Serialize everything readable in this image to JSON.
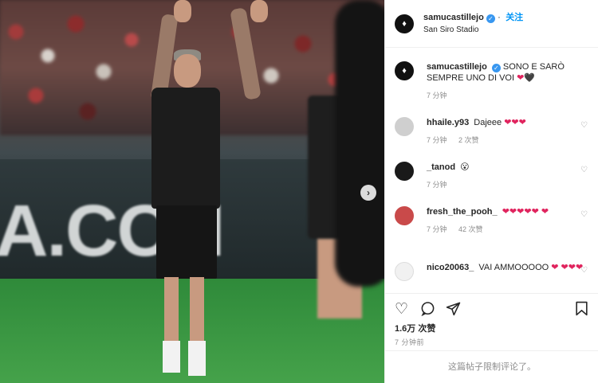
{
  "photo": {
    "ad_text": "A.CON",
    "next_icon": "chevron-right-icon"
  },
  "post": {
    "username": "samucastillejo",
    "verified_icon": "verified-badge-icon",
    "follow_label": "关注",
    "location": "San Siro Stadio"
  },
  "caption": {
    "username": "samucastillejo",
    "text": "SONO E SARÒ SEMPRE UNO DI VOI",
    "emoji": "❤🖤",
    "time": "7 分钟"
  },
  "comments": [
    {
      "username": "hhaile.y93",
      "text": "Dajeee",
      "emoji": "❤❤❤",
      "time": "7 分钟",
      "likes": "2 次赞",
      "avatar_color": "#cfcfcf"
    },
    {
      "username": "_tanod",
      "text": "",
      "emoji": "😮",
      "time": "7 分钟",
      "likes": "",
      "avatar_color": "#1a1a1a"
    },
    {
      "username": "fresh_the_pooh_",
      "text": "",
      "emoji": "❤❤❤❤❤ ❤",
      "time": "7 分钟",
      "likes": "42 次赞",
      "avatar_color": "#c94a4a"
    },
    {
      "username": "nico20063_",
      "text": "VAI AMMOOOOO",
      "emoji": "❤ ❤❤❤",
      "time": "",
      "likes": "",
      "avatar_color": "#f1f1f1"
    }
  ],
  "actions": {
    "like_icon": "heart-icon",
    "comment_icon": "comment-icon",
    "share_icon": "share-icon",
    "save_icon": "bookmark-icon"
  },
  "stats": {
    "likes": "1.6万 次赞",
    "time": "7 分钟前"
  },
  "footer": {
    "restricted_text": "这篇帖子限制评论了。"
  },
  "colors": {
    "accent": "#0095f6",
    "heart": "#e0245e",
    "muted": "#8e8e8e"
  }
}
